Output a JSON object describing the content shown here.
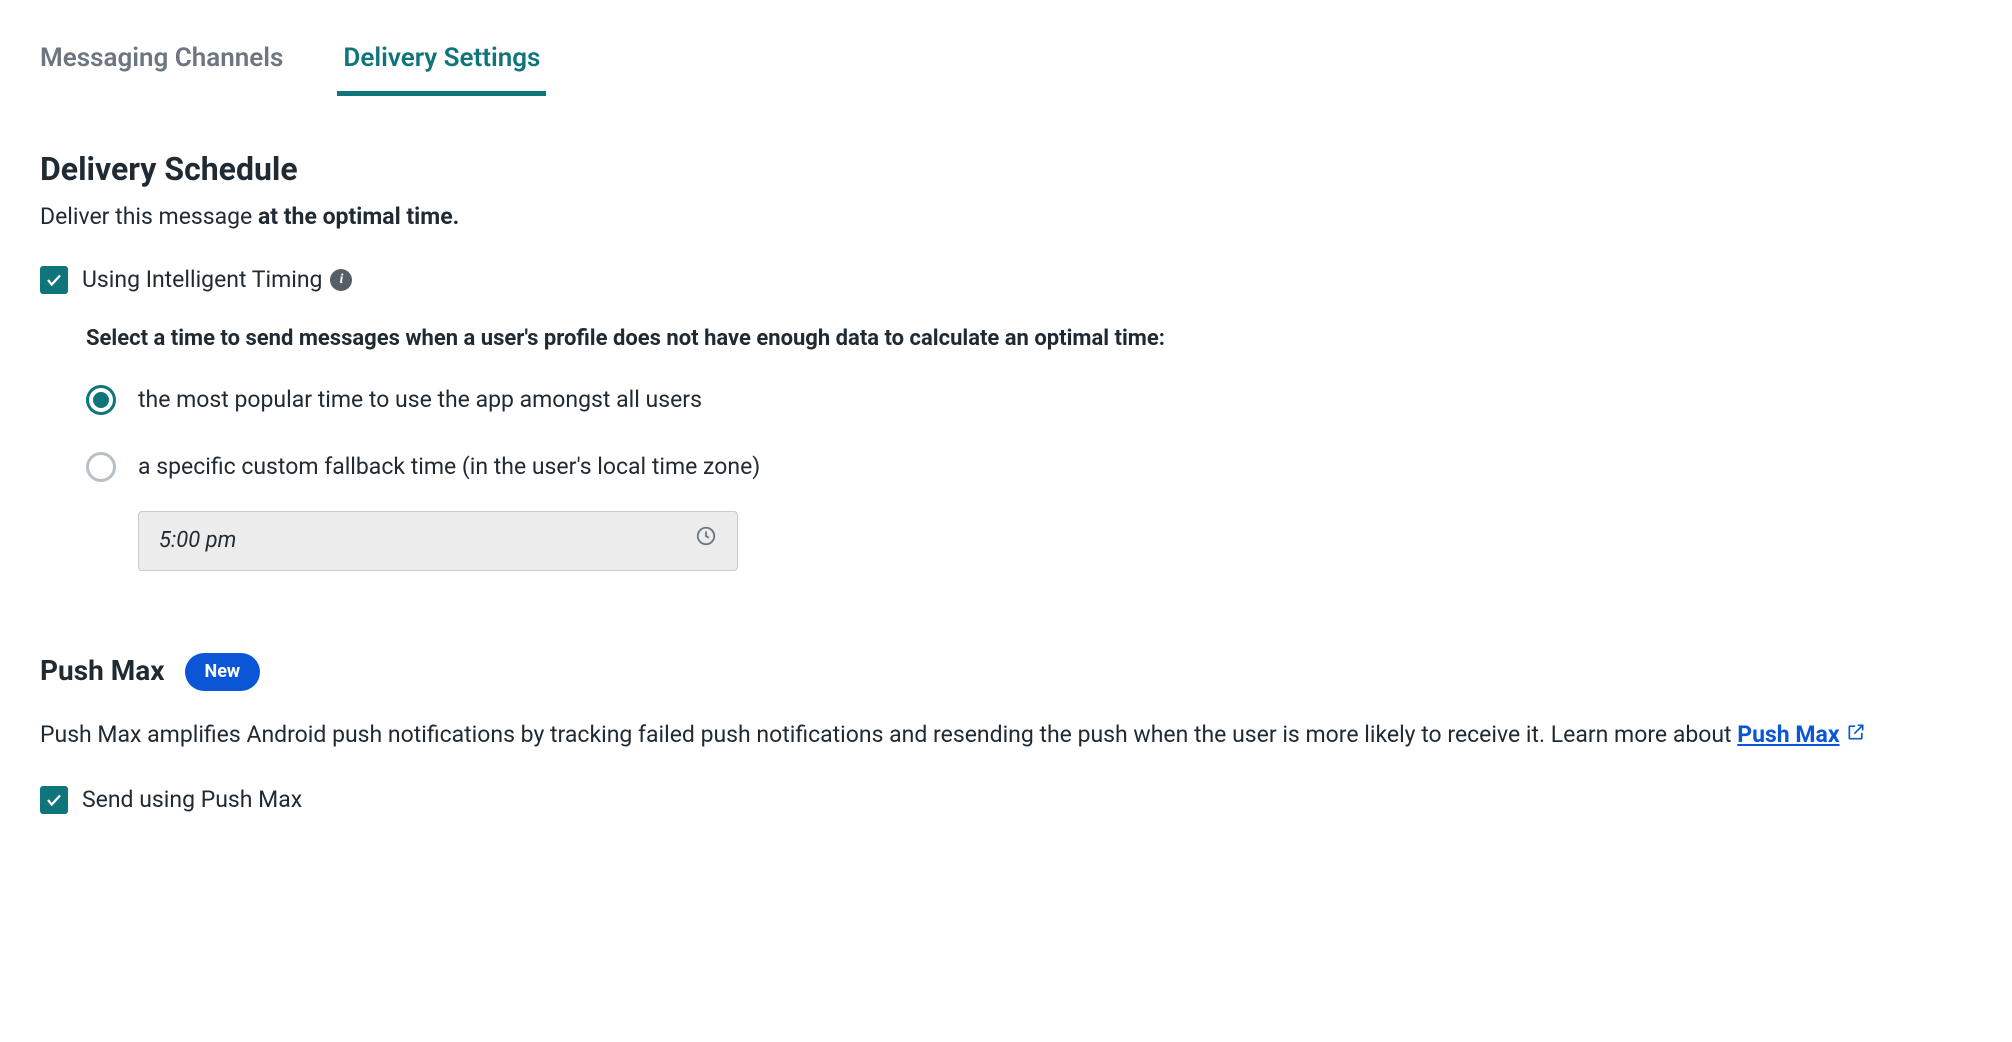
{
  "tabs": {
    "messaging": "Messaging Channels",
    "delivery": "Delivery Settings"
  },
  "schedule": {
    "title": "Delivery Schedule",
    "subtitle_prefix": "Deliver this message ",
    "subtitle_bold": "at the optimal time.",
    "intelligent_timing_label": "Using Intelligent Timing",
    "prompt": "Select a time to send messages when a user's profile does not have enough data to calculate an optimal time:",
    "option_popular": "the most popular time to use the app amongst all users",
    "option_custom": "a specific custom fallback time (in the user's local time zone)",
    "time_value": "5:00 pm"
  },
  "pushmax": {
    "title": "Push Max",
    "badge": "New",
    "desc_prefix": "Push Max amplifies Android push notifications by tracking failed push notifications and resending the push when the user is more likely to receive it. Learn more about ",
    "link_text": "Push Max",
    "checkbox_label": "Send using Push Max"
  }
}
